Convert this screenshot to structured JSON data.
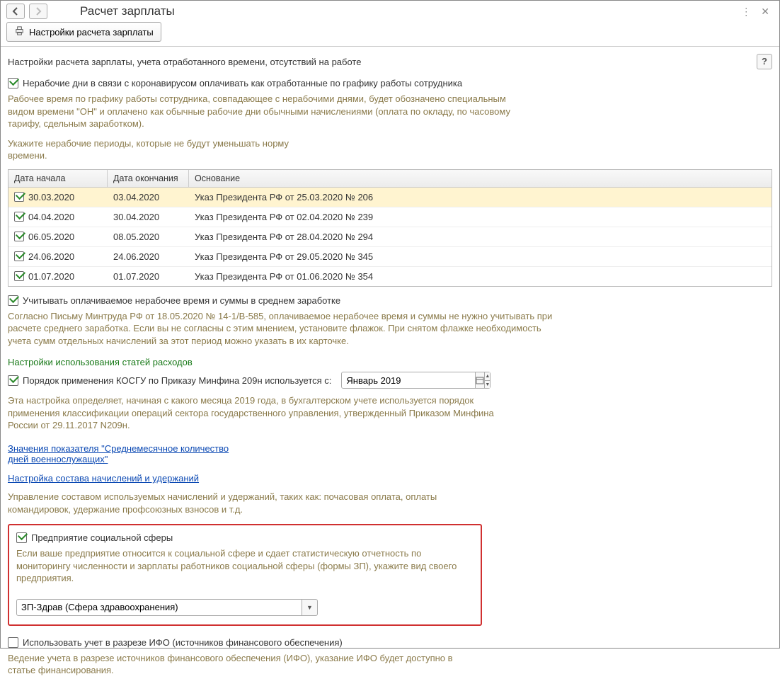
{
  "header": {
    "title": "Расчет зарплаты"
  },
  "toolbar": {
    "settings_label": "Настройки расчета зарплаты"
  },
  "subtitle": "Настройки расчета зарплаты, учета отработанного времени, отсутствий на работе",
  "help_label": "?",
  "nonworking": {
    "checkbox_label": "Нерабочие дни в связи с коронавирусом оплачивать как отработанные по графику работы сотрудника",
    "description": "Рабочее время по графику работы сотрудника, совпадающее с нерабочими днями, будет обозначено специальным видом времени \"ОН\" и оплачено как обычные рабочие дни обычными начислениями (оплата по окладу, по часовому тарифу, сдельным заработком).",
    "hint": "Укажите нерабочие периоды, которые не будут уменьшать норму времени."
  },
  "table": {
    "col_start": "Дата начала",
    "col_end": "Дата окончания",
    "col_basis": "Основание",
    "rows": [
      {
        "start": "30.03.2020",
        "end": "03.04.2020",
        "basis": "Указ Президента РФ от 25.03.2020 № 206",
        "selected": true
      },
      {
        "start": "04.04.2020",
        "end": "30.04.2020",
        "basis": "Указ Президента РФ от 02.04.2020 № 239",
        "selected": false
      },
      {
        "start": "06.05.2020",
        "end": "08.05.2020",
        "basis": "Указ Президента РФ от 28.04.2020 № 294",
        "selected": false
      },
      {
        "start": "24.06.2020",
        "end": "24.06.2020",
        "basis": "Указ Президента РФ от 29.05.2020 № 345",
        "selected": false
      },
      {
        "start": "01.07.2020",
        "end": "01.07.2020",
        "basis": "Указ Президента РФ от 01.06.2020 № 354",
        "selected": false
      }
    ]
  },
  "average": {
    "checkbox_label": "Учитывать оплачиваемое нерабочее время и суммы в среднем заработке",
    "description": "Согласно Письму Минтруда РФ от 18.05.2020 № 14-1/В-585, оплачиваемое нерабочее время и суммы не нужно учитывать при расчете среднего заработка. Если вы не согласны с этим мнением, установите флажок. При снятом флажке необходимость учета сумм отдельных начислений за этот период можно указать в их карточке."
  },
  "expense": {
    "heading": "Настройки использования статей расходов",
    "kosgu_label": "Порядок применения КОСГУ по Приказу Минфина 209н используется с:",
    "kosgu_value": "Январь 2019",
    "description": "Эта настройка определяет, начиная с какого месяца 2019 года, в бухгалтерском учете используется порядок применения классификации операций сектора государственного управления, утвержденный Приказом Минфина России от 29.11.2017 N209н."
  },
  "links": {
    "military": "Значения показателя \"Среднемесячное количество дней военнослужащих\"",
    "accruals": "Настройка состава начислений и удержаний"
  },
  "accruals_hint": "Управление составом используемых начислений и удержаний, таких как: почасовая оплата, оплаты командировок, удержание профсоюзных взносов и т.д.",
  "social": {
    "checkbox_label": "Предприятие социальной сферы",
    "description": "Если ваше предприятие относится к социальной сфере и сдает статистическую отчетность по мониторингу численности и зарплаты работников социальной сферы (формы ЗП), укажите вид своего предприятия.",
    "combo_value": "ЗП-Здрав (Сфера здравоохранения)"
  },
  "ifo": {
    "checkbox_label": "Использовать учет в разрезе ИФО (источников финансового обеспечения)",
    "description": "Ведение учета в разрезе источников финансового обеспечения (ИФО), указание ИФО будет доступно в статье финансирования."
  }
}
